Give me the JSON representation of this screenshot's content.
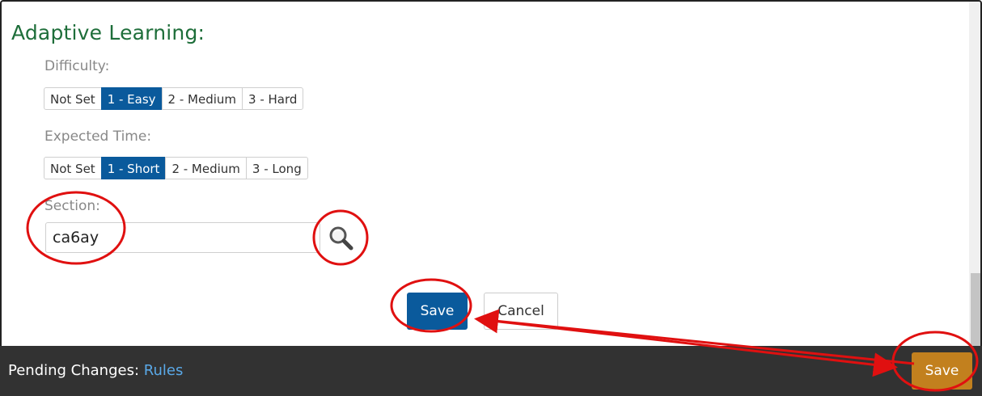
{
  "section_title": "Adaptive Learning:",
  "difficulty": {
    "label": "Difficulty:",
    "options": [
      "Not Set",
      "1 - Easy",
      "2 - Medium",
      "3 - Hard"
    ],
    "selected": "1 - Easy"
  },
  "expected_time": {
    "label": "Expected Time:",
    "options": [
      "Not Set",
      "1 - Short",
      "2 - Medium",
      "3 - Long"
    ],
    "selected": "1 - Short"
  },
  "section": {
    "label": "Section:",
    "value": "ca6ay",
    "search_icon": "magnifier-icon"
  },
  "actions": {
    "save_label": "Save",
    "cancel_label": "Cancel"
  },
  "footer": {
    "pending_label": "Pending Changes:",
    "pending_link": "Rules",
    "save_label": "Save"
  },
  "colors": {
    "title_green": "#1e6e3a",
    "primary_blue": "#0a5a9c",
    "footer_bg": "#323232",
    "footer_save": "#c2801e",
    "link_blue": "#5aa9e8",
    "annotation_red": "#e01010"
  }
}
